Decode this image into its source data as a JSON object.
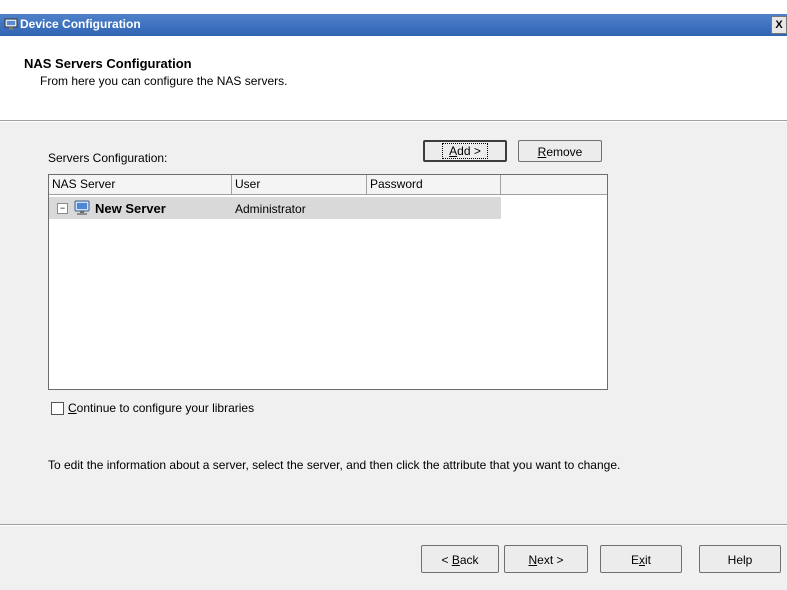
{
  "window": {
    "title": "Device Configuration",
    "close_glyph": "X",
    "icon": "device-config-icon"
  },
  "header": {
    "title": "NAS Servers Configuration",
    "subtitle": "From here you can configure the NAS servers."
  },
  "servers": {
    "label": "Servers Configuration:",
    "add_button": {
      "accel": "A",
      "rest": "dd >"
    },
    "remove_button": {
      "accel": "R",
      "rest": "emove"
    },
    "columns": [
      "NAS Server",
      "User",
      "Password"
    ],
    "rows": [
      {
        "name": "New Server",
        "user": "Administrator",
        "password": "",
        "icon": "server-computer-icon",
        "expand_glyph": "−"
      }
    ]
  },
  "options": {
    "continue_checkbox": {
      "checked": false,
      "accel": "C",
      "rest": "ontinue to configure your libraries"
    }
  },
  "info_text": "To edit the information about a server, select the server, and then click the attribute that you want to change.",
  "footer": {
    "back": {
      "prefix": "< ",
      "accel": "B",
      "rest": "ack"
    },
    "next": {
      "accel": "N",
      "rest": "ext >"
    },
    "exit": {
      "pre": "E",
      "accel": "x",
      "rest": "it"
    },
    "help": "Help"
  }
}
